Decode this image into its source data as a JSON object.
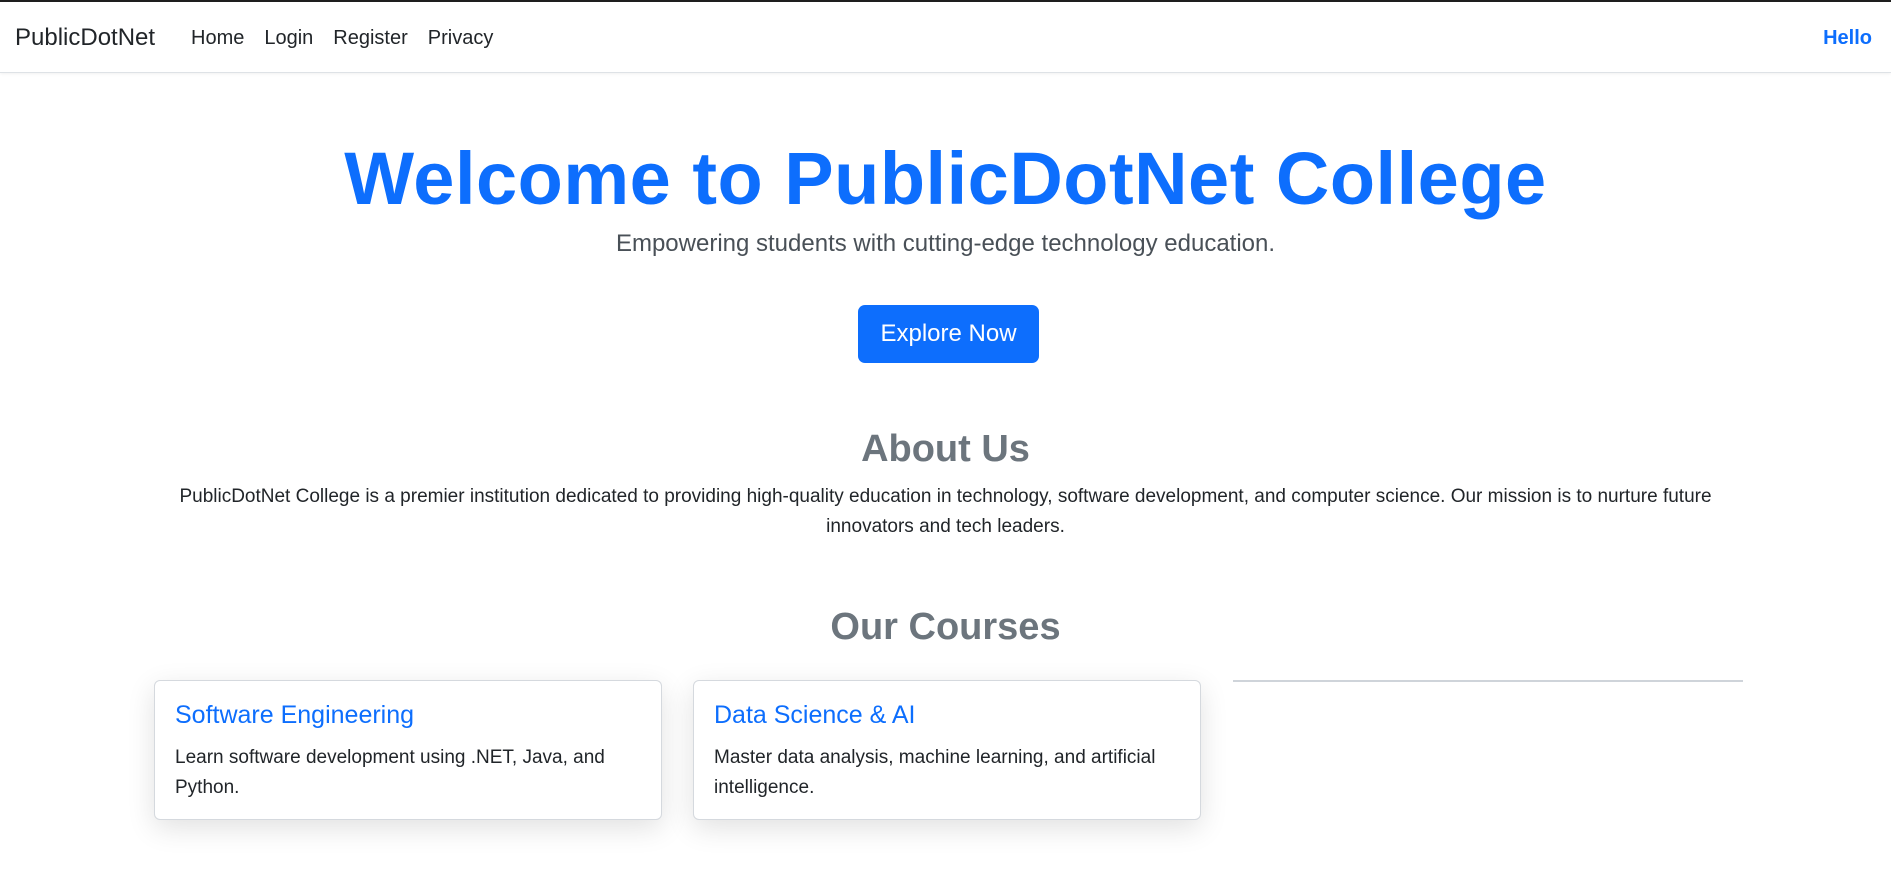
{
  "navbar": {
    "brand": "PublicDotNet",
    "links": [
      "Home",
      "Login",
      "Register",
      "Privacy"
    ],
    "greeting": "Hello"
  },
  "hero": {
    "title": "Welcome to PublicDotNet College",
    "subtitle": "Empowering students with cutting-edge technology education.",
    "button_label": "Explore Now"
  },
  "about": {
    "title": "About Us",
    "text": "PublicDotNet College is a premier institution dedicated to providing high-quality education in technology, software development, and computer science. Our mission is to nurture future innovators and tech leaders."
  },
  "courses": {
    "title": "Our Courses",
    "items": [
      {
        "title": "Software Engineering",
        "description": "Learn software development using .NET, Java, and Python."
      },
      {
        "title": "Data Science & AI",
        "description": "Master data analysis, machine learning, and artificial intelligence."
      }
    ]
  },
  "colors": {
    "accent": "#0d6efd",
    "heading_muted": "#6c757d",
    "text": "#212529"
  }
}
